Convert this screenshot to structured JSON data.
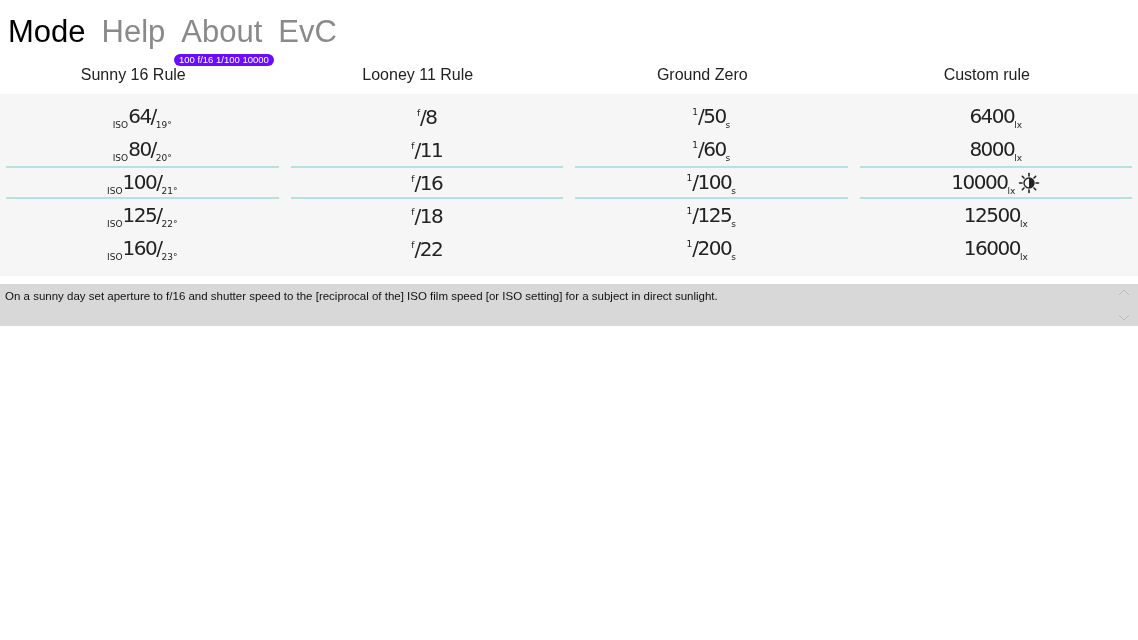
{
  "menu": [
    {
      "label": "Mode",
      "selected": true
    },
    {
      "label": "Help",
      "selected": false
    },
    {
      "label": "About",
      "selected": false
    },
    {
      "label": "EvC",
      "selected": false
    }
  ],
  "badge": "100 f/16 1/100 10000",
  "columns": [
    {
      "title": "Sunny 16 Rule",
      "items": [
        {
          "text": "$_{ISO}$64/$_{19°}$",
          "selected": false
        },
        {
          "text": "$_{ISO}$80/$_{20°}$",
          "selected": false
        },
        {
          "text": "$_{ISO}$100/$_{21°}$",
          "selected": true
        },
        {
          "text": "$_{ISO}$125/$_{22°}$",
          "selected": false
        },
        {
          "text": "$_{ISO}$160/$_{23°}$",
          "selected": false
        }
      ]
    },
    {
      "title": "Looney 11 Rule",
      "items": [
        {
          "text": "$^{f}$/8",
          "selected": false
        },
        {
          "text": "$^{f}$/11",
          "selected": false
        },
        {
          "text": "$^{f}$/16",
          "selected": true
        },
        {
          "text": "$^{f}$/18",
          "selected": false
        },
        {
          "text": "$^{f}$/22",
          "selected": false
        }
      ]
    },
    {
      "title": "Ground Zero",
      "items": [
        {
          "text": "$^{1}$/50$_{s}$",
          "selected": false
        },
        {
          "text": "$^{1}$/60$_{s}$",
          "selected": false
        },
        {
          "text": "$^{1}$/100$_{s}$",
          "selected": true
        },
        {
          "text": "$^{1}$/125$_{s}$",
          "selected": false
        },
        {
          "text": "$^{1}$/200$_{s}$",
          "selected": false
        }
      ]
    },
    {
      "title": "Custom rule",
      "items": [
        {
          "text": "6400$_{lx}$",
          "selected": false,
          "kind": "plain"
        },
        {
          "text": "8000$_{lx}$",
          "selected": false,
          "kind": "plain"
        },
        {
          "text": "10000$_{lx}$",
          "selected": true,
          "kind": "marked"
        },
        {
          "text": "12500$_{lx}$",
          "selected": false,
          "kind": "plain"
        },
        {
          "text": "16000$_{lx}$",
          "selected": false,
          "kind": "plain"
        }
      ]
    }
  ],
  "description": "On a sunny day set aperture to f/16 and shutter speed to the [reciprocal of the] ISO film speed [or ISO setting] for a subject in direct sunlight."
}
